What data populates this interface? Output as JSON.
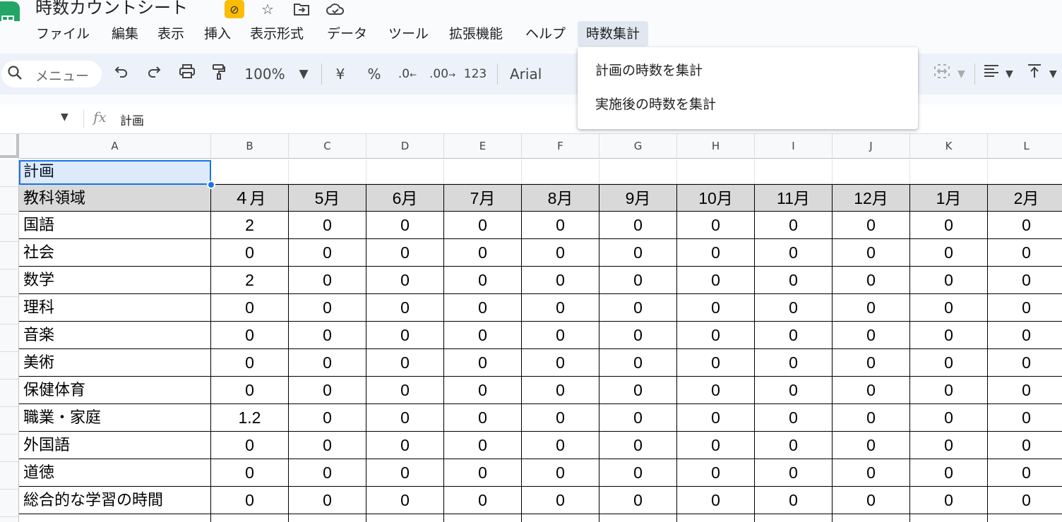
{
  "title_bar": {
    "doc_title": "時数カウントシート",
    "icons": [
      "cloud-off-badge-icon",
      "star-icon",
      "move-to-folder-icon",
      "cloud-status-icon"
    ]
  },
  "menu": {
    "items": [
      "ファイル",
      "編集",
      "表示",
      "挿入",
      "表示形式",
      "データ",
      "ツール",
      "拡張機能",
      "ヘルプ",
      "時数集計"
    ],
    "active": "時数集計"
  },
  "toolbar": {
    "search_label": "メニュー",
    "zoom": "100%",
    "currency": "¥",
    "percent": "%",
    "decrease_decimal": ".0",
    "increase_decimal": ".00",
    "number_format": "123",
    "font": "Arial"
  },
  "dropdown": {
    "items": [
      "計画の時数を集計",
      "実施後の時数を集計"
    ]
  },
  "formula_bar": {
    "fx": "fx",
    "content": "計画"
  },
  "sheet": {
    "columns": [
      "A",
      "B",
      "C",
      "D",
      "E",
      "F",
      "G",
      "H",
      "I",
      "J",
      "K",
      "L"
    ],
    "title_cell": "計画",
    "header_row": [
      "教科領域",
      "４月",
      "5月",
      "6月",
      "7月",
      "8月",
      "9月",
      "10月",
      "11月",
      "12月",
      "1月",
      "2月"
    ],
    "rows": [
      [
        "国語",
        "2",
        "0",
        "0",
        "0",
        "0",
        "0",
        "0",
        "0",
        "0",
        "0",
        "0"
      ],
      [
        "社会",
        "0",
        "0",
        "0",
        "0",
        "0",
        "0",
        "0",
        "0",
        "0",
        "0",
        "0"
      ],
      [
        "数学",
        "2",
        "0",
        "0",
        "0",
        "0",
        "0",
        "0",
        "0",
        "0",
        "0",
        "0"
      ],
      [
        "理科",
        "0",
        "0",
        "0",
        "0",
        "0",
        "0",
        "0",
        "0",
        "0",
        "0",
        "0"
      ],
      [
        "音楽",
        "0",
        "0",
        "0",
        "0",
        "0",
        "0",
        "0",
        "0",
        "0",
        "0",
        "0"
      ],
      [
        "美術",
        "0",
        "0",
        "0",
        "0",
        "0",
        "0",
        "0",
        "0",
        "0",
        "0",
        "0"
      ],
      [
        "保健体育",
        "0",
        "0",
        "0",
        "0",
        "0",
        "0",
        "0",
        "0",
        "0",
        "0",
        "0"
      ],
      [
        "職業・家庭",
        "1.2",
        "0",
        "0",
        "0",
        "0",
        "0",
        "0",
        "0",
        "0",
        "0",
        "0"
      ],
      [
        "外国語",
        "0",
        "0",
        "0",
        "0",
        "0",
        "0",
        "0",
        "0",
        "0",
        "0",
        "0"
      ],
      [
        "道徳",
        "0",
        "0",
        "0",
        "0",
        "0",
        "0",
        "0",
        "0",
        "0",
        "0",
        "0"
      ],
      [
        "総合的な学習の時間",
        "0",
        "0",
        "0",
        "0",
        "0",
        "0",
        "0",
        "0",
        "0",
        "0",
        "0"
      ]
    ]
  }
}
